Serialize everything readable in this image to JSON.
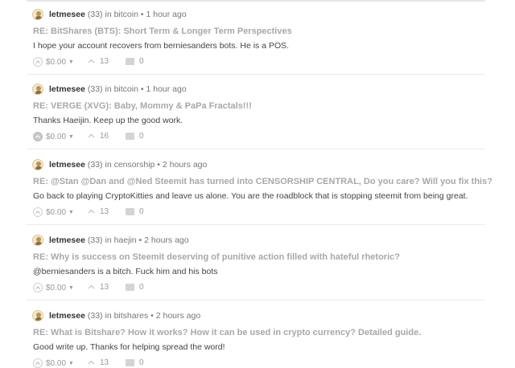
{
  "posts": [
    {
      "author": "letmesee",
      "reputation": "(33)",
      "in_text": "in",
      "category": "bitcoin",
      "sep": "•",
      "time": "1 hour ago",
      "title": "RE: BitShares (BTS): Short Term & Longer Term Perspectives",
      "body": "I hope your account recovers from berniesanders bots. He is a POS.",
      "payout": "$0.00",
      "votes": "13",
      "replies": "0",
      "upvote_style": "outline"
    },
    {
      "author": "letmesee",
      "reputation": "(33)",
      "in_text": "in",
      "category": "bitcoin",
      "sep": "•",
      "time": "1 hour ago",
      "title": "RE: VERGE (XVG): Baby, Mommy & PaPa Fractals!!!",
      "body": "Thanks Haeijin. Keep up the good work.",
      "payout": "$0.00",
      "votes": "16",
      "replies": "0",
      "upvote_style": "filled"
    },
    {
      "author": "letmesee",
      "reputation": "(33)",
      "in_text": "in",
      "category": "censorship",
      "sep": "•",
      "time": "2 hours ago",
      "title": "RE: @Stan @Dan and @Ned Steemit has turned into CENSORSHIP CENTRAL, Do you care? Will you fix this?",
      "body": "Go back to playing CryptoKitties and leave us alone. You are the roadblock that is stopping steemit from being great.",
      "payout": "$0.00",
      "votes": "13",
      "replies": "0",
      "upvote_style": "outline"
    },
    {
      "author": "letmesee",
      "reputation": "(33)",
      "in_text": "in",
      "category": "haejin",
      "sep": "•",
      "time": "2 hours ago",
      "title": "RE: Why is success on Steemit deserving of punitive action filled with hateful rhetoric?",
      "body": "@berniesanders is a bitch. Fuck him and his bots",
      "payout": "$0.00",
      "votes": "13",
      "replies": "0",
      "upvote_style": "outline"
    },
    {
      "author": "letmesee",
      "reputation": "(33)",
      "in_text": "in",
      "category": "bitshares",
      "sep": "•",
      "time": "2 hours ago",
      "title": "RE: What is Bitshare? How it works? How it can be used in crypto currency? Detailed guide.",
      "body": "Good write up. Thanks for helping spread the word!",
      "payout": "$0.00",
      "votes": "13",
      "replies": "0",
      "upvote_style": "outline"
    }
  ],
  "colors": {
    "title": "#a8a8a8",
    "meta": "#777777",
    "divider": "#ececec"
  }
}
